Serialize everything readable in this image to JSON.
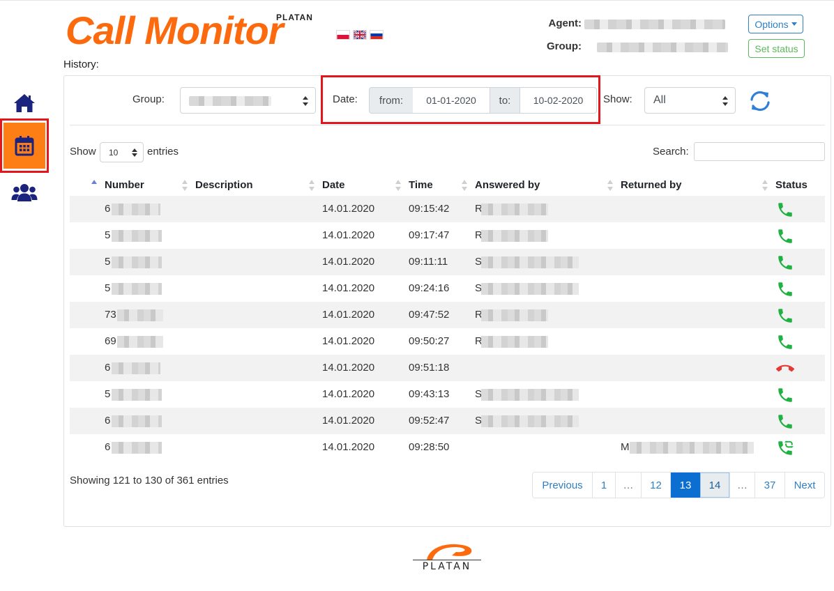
{
  "app": {
    "logo_text": "Call Monitor",
    "logo_brand": "PLATAN",
    "footer_brand": "PLATAN"
  },
  "header": {
    "agent_label": "Agent:",
    "group_label": "Group:",
    "options_label": "Options",
    "set_status_label": "Set status",
    "languages": [
      "pl",
      "en",
      "ru"
    ]
  },
  "page": {
    "title": "History:"
  },
  "filters": {
    "group_label": "Group:",
    "date_label": "Date:",
    "from_label": "from:",
    "from_value": "01-01-2020",
    "to_label": "to:",
    "to_value": "10-02-2020",
    "show_label": "Show:",
    "show_value": "All"
  },
  "table_controls": {
    "show_label": "Show",
    "length_value": "10",
    "entries_label": "entries",
    "search_label": "Search:",
    "search_value": ""
  },
  "table": {
    "columns": [
      "Number",
      "Description",
      "Date",
      "Time",
      "Answered by",
      "Returned by",
      "Status"
    ],
    "rows": [
      {
        "number": "6",
        "date": "14.01.2020",
        "time": "09:15:42",
        "answered": "R",
        "returned": "",
        "status": "answered"
      },
      {
        "number": "5",
        "date": "14.01.2020",
        "time": "09:17:47",
        "answered": "R",
        "returned": "",
        "status": "answered"
      },
      {
        "number": "5",
        "date": "14.01.2020",
        "time": "09:11:11",
        "answered": "S",
        "returned": "",
        "status": "answered"
      },
      {
        "number": "5",
        "date": "14.01.2020",
        "time": "09:24:16",
        "answered": "S",
        "returned": "",
        "status": "answered"
      },
      {
        "number": "73",
        "date": "14.01.2020",
        "time": "09:47:52",
        "answered": "R",
        "returned": "",
        "status": "answered"
      },
      {
        "number": "69",
        "date": "14.01.2020",
        "time": "09:50:27",
        "answered": "R",
        "returned": "",
        "status": "answered"
      },
      {
        "number": "6",
        "date": "14.01.2020",
        "time": "09:51:18",
        "answered": "",
        "returned": "",
        "status": "missed"
      },
      {
        "number": "5",
        "date": "14.01.2020",
        "time": "09:43:13",
        "answered": "S",
        "returned": "",
        "status": "answered"
      },
      {
        "number": "6",
        "date": "14.01.2020",
        "time": "09:52:47",
        "answered": "S",
        "returned": "",
        "status": "answered"
      },
      {
        "number": "6",
        "date": "14.01.2020",
        "time": "09:28:50",
        "answered": "",
        "returned": "M",
        "status": "returned"
      }
    ]
  },
  "pagination": {
    "info": "Showing 121 to 130 of 361 entries",
    "items": [
      "Previous",
      "1",
      "…",
      "12",
      "13",
      "14",
      "…",
      "37",
      "Next"
    ],
    "active": "13"
  },
  "icons": {
    "nav": [
      "home-icon",
      "calendar-icon",
      "users-icon"
    ],
    "refresh": "refresh-icon",
    "status": {
      "answered": "phone-icon",
      "missed": "phone-hangup-icon",
      "returned": "phone-callback-icon"
    }
  },
  "colors": {
    "brand_orange": "#fd6a0d",
    "nav_active_bg": "#fd7e14",
    "nav_icon": "#1a237e",
    "highlight_red": "#e3161b",
    "answered_green": "#1fb141",
    "missed_red": "#e53935",
    "link_blue": "#2f7fc2",
    "active_page": "#0d6ed1"
  }
}
